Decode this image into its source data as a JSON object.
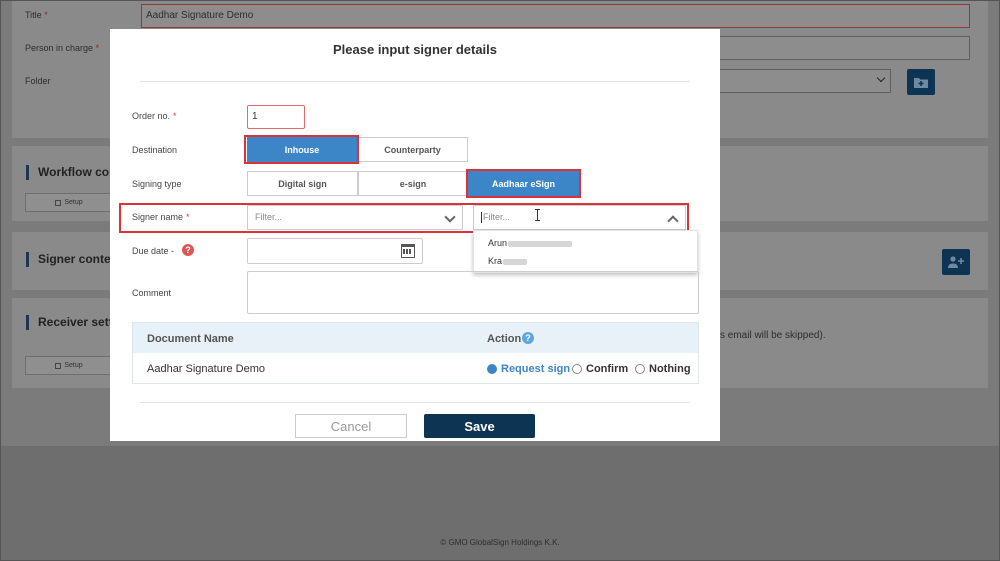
{
  "background": {
    "title_label": "Title",
    "title_value": "Aadhar Signature Demo",
    "person_label": "Person in charge",
    "folder_label": "Folder",
    "required_mark": "*",
    "workflow_section": "Workflow cor",
    "signer_section": "Signer conte",
    "receiver_section": "Receiver sett",
    "setup_label": "Setup",
    "receiver_note": "s email will be skipped).",
    "footer": "© GMO GlobalSign Holdings K.K."
  },
  "modal": {
    "title": "Please input signer details",
    "order_label": "Order no.",
    "order_value": "1",
    "required_mark": "*",
    "destination_label": "Destination",
    "destination_options": [
      "Inhouse",
      "Counterparty"
    ],
    "destination_selected": "Inhouse",
    "signing_type_label": "Signing type",
    "signing_type_options": [
      "Digital sign",
      "e-sign",
      "Aadhaar eSign"
    ],
    "signing_type_selected": "Aadhaar eSign",
    "signer_name_label": "Signer name",
    "signer_filter_1_placeholder": "Filter...",
    "signer_filter_2_placeholder": "Filter...",
    "dropdown_items": [
      "Arun",
      "Kra"
    ],
    "due_date_label": "Due date -",
    "help_symbol": "?",
    "comment_label": "Comment",
    "table": {
      "col_document": "Document Name",
      "col_action": "Action",
      "row_document": "Aadhar Signature Demo",
      "actions": [
        "Request sign",
        "Confirm",
        "Nothing"
      ],
      "selected_action": "Request sign"
    },
    "cancel_label": "Cancel",
    "save_label": "Save"
  },
  "colors": {
    "accent": "#3c86c8",
    "primary_button": "#0e3453",
    "highlight": "#d9323a",
    "required": "#d93a3a"
  }
}
